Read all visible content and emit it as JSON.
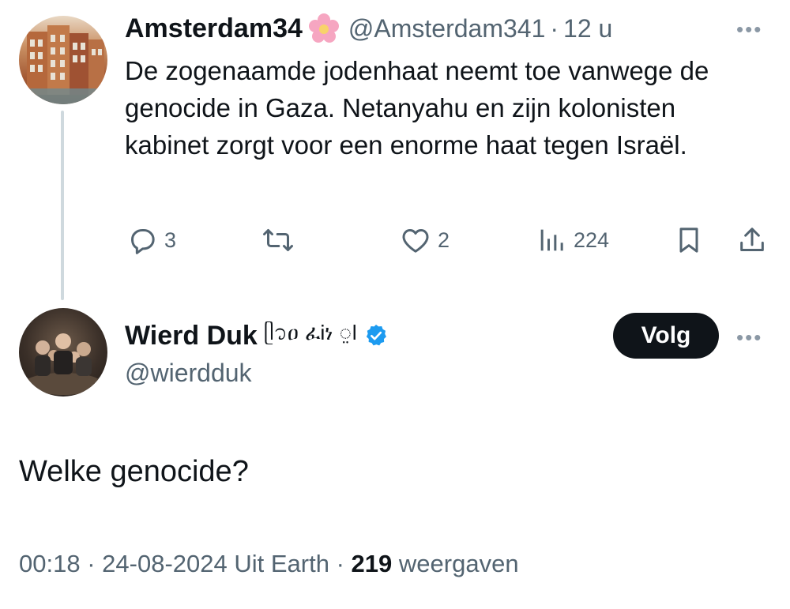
{
  "tweet1": {
    "display_name": "Amsterdam34",
    "name_emoji": "flower-emoji",
    "handle": "@Amsterdam341",
    "separator": "·",
    "time": "12 u",
    "text": "De zogenaamde jodenhaat neemt toe vanwege de genocide in Gaza. Netanyahu en zijn kolonisten kabinet zorgt voor een enorme haat tegen Israël.",
    "actions": {
      "replies": "3",
      "retweets": "",
      "likes": "2",
      "views": "224"
    },
    "more_label": "•••"
  },
  "tweet2": {
    "display_name": "Wierd Duk",
    "name_script": "ᥫ᭡ዐ ፈᎥነ ࡙ߊ",
    "verified": true,
    "handle": "@wierdduk",
    "follow_label": "Volg",
    "more_label": "•••",
    "text": "Welke genocide?",
    "meta": {
      "time": "00:18",
      "sep1": "·",
      "date": "24-08-2024",
      "source": "Uit Earth",
      "sep2": "·",
      "views_count": "219",
      "views_label": "weergaven"
    }
  },
  "colors": {
    "text": "#0f1419",
    "secondary": "#536471",
    "verified_blue": "#1d9bf0",
    "thread_line": "#cfd9de",
    "follow_bg": "#0f1419"
  }
}
